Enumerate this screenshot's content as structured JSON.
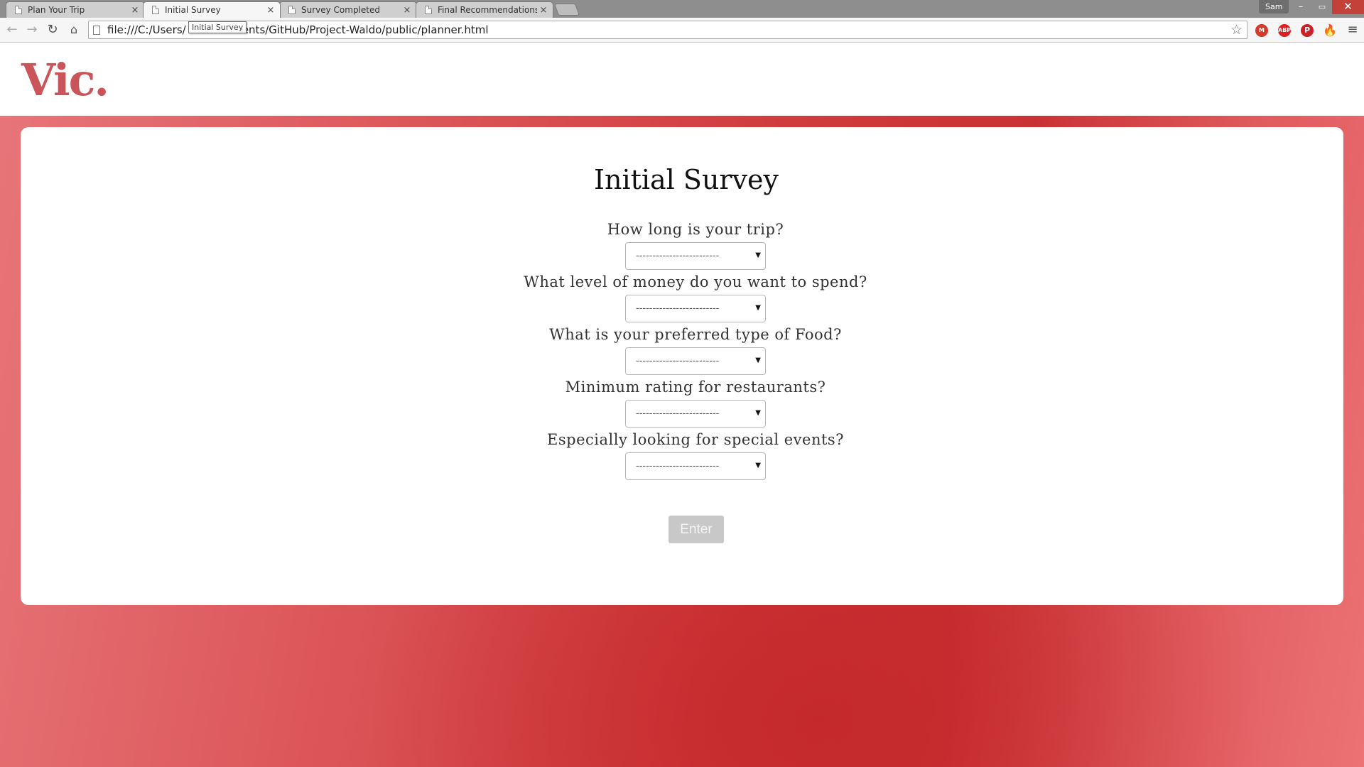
{
  "browser": {
    "tabs": [
      {
        "title": "Plan Your Trip",
        "close": "×"
      },
      {
        "title": "Initial Survey",
        "close": "×"
      },
      {
        "title": "Survey Completed",
        "close": "×"
      },
      {
        "title": "Final Recommendations",
        "close": "×"
      }
    ],
    "active_tab_index": 1,
    "profile_name": "Sam",
    "window_controls": {
      "minimize": "–",
      "maximize": "▭",
      "close": "✕"
    },
    "url": "file:///C:/Users/…/Documents/GitHub/Project-Waldo/public/planner.html",
    "url_visible_prefix": "file:///C:/Users/",
    "url_visible_suffix": "uments/GitHub/Project-Waldo/public/planner.html",
    "tooltip": "Initial Survey",
    "nav_icons": {
      "back": "←",
      "forward": "→",
      "reload": "↻",
      "home": "⌂",
      "star": "☆",
      "menu": "≡"
    },
    "extensions": [
      {
        "icon": "mail-checker-icon",
        "label": "M",
        "color": "#d23a2c"
      },
      {
        "icon": "adblock-plus-icon",
        "label": "ABP",
        "color": "#e02020"
      },
      {
        "icon": "pinterest-icon",
        "label": "P",
        "color": "#cb2027"
      },
      {
        "icon": "fire-icon",
        "label": "🔥",
        "color": "#e8491d"
      }
    ]
  },
  "site": {
    "logo": "Vic.",
    "brand_color": "#c9545a"
  },
  "survey": {
    "title": "Initial Survey",
    "questions": [
      {
        "label": "How long is your trip?",
        "selected": "-------------------------"
      },
      {
        "label": "What level of money do you want to spend?",
        "selected": "-------------------------"
      },
      {
        "label": "What is your preferred type of Food?",
        "selected": "-------------------------"
      },
      {
        "label": "Minimum rating for restaurants?",
        "selected": "-------------------------"
      },
      {
        "label": "Especially looking for special events?",
        "selected": "-------------------------"
      }
    ],
    "select_caret": "▼",
    "submit_label": "Enter"
  }
}
